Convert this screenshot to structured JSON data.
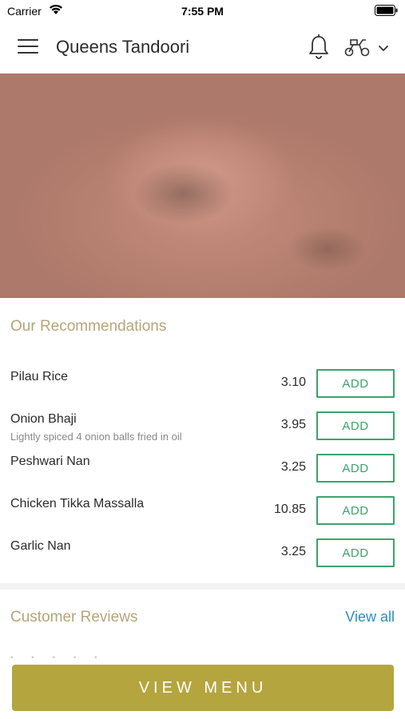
{
  "status_bar": {
    "carrier": "Carrier",
    "time": "7:55 PM"
  },
  "app_bar": {
    "title": "Queens Tandoori",
    "icons": [
      "menu-icon",
      "bell-icon",
      "scooter-icon",
      "chevron-down-icon"
    ]
  },
  "recommendations": {
    "title": "Our Recommendations",
    "add_label": "ADD",
    "items": [
      {
        "name": "Pilau Rice",
        "description": "",
        "price": "3.10"
      },
      {
        "name": "Onion Bhaji",
        "description": "Lightly spiced 4 onion balls fried in oil",
        "price": "3.95"
      },
      {
        "name": "Peshwari Nan",
        "description": "",
        "price": "3.25"
      },
      {
        "name": "Chicken Tikka Massalla",
        "description": "",
        "price": "10.85"
      },
      {
        "name": "Garlic Nan",
        "description": "",
        "price": "3.25"
      }
    ]
  },
  "reviews": {
    "title": "Customer Reviews",
    "view_all": "View all"
  },
  "footer": {
    "view_menu": "VIEW MENU"
  },
  "colors": {
    "accent_gold": "#b5a53e",
    "section_title": "#b5a57a",
    "add_green": "#3aa56a",
    "link_blue": "#2a8fc0"
  }
}
